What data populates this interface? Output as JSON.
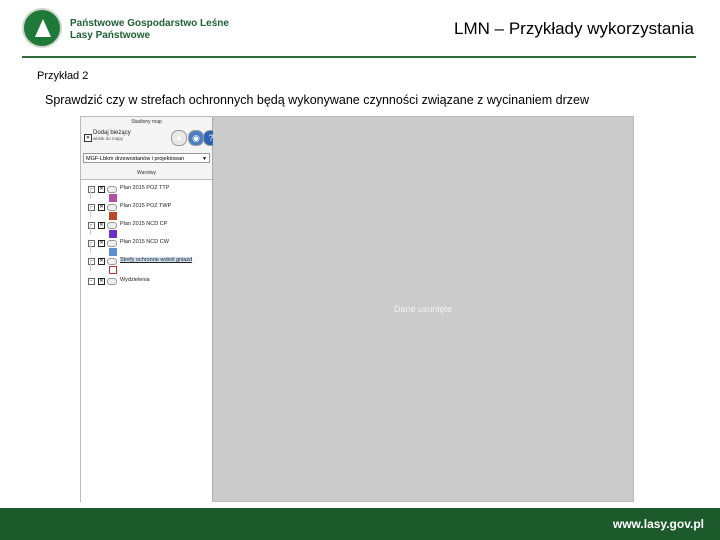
{
  "header": {
    "org_line1": "Państwowe Gospodarstwo Leśne",
    "org_line2": "Lasy Państwowe",
    "title": "LMN – Przykłady wykorzystania"
  },
  "content": {
    "example_label": "Przykład 2",
    "description": "Sprawdzić czy w strefach ochronnych będą wykonywane czynności związane z wycinaniem drzew"
  },
  "qgis": {
    "panel_title": "Stadiony map",
    "add_label": "Dodaj bieżący",
    "add_sub": "widok do mapy",
    "select_value": "MGF-Lbkm drzewostanów i projektowan",
    "layers_title": "Warstwy",
    "layers": [
      {
        "name": "Plan 2015 POZ TTP",
        "swatch": "#b14fa8"
      },
      {
        "name": "Plan 2015 POZ TWP",
        "swatch": "#b84a2a"
      },
      {
        "name": "Plan 2015 NCD CP",
        "swatch": "#6a2fc9"
      },
      {
        "name": "Plan 2015 NCD CW",
        "swatch": "#5c8fd6"
      },
      {
        "name": "Strefy ochronne wokół gniazd",
        "swatch": "#ffffff"
      },
      {
        "name": "Wydzielenia",
        "swatch": ""
      }
    ],
    "canvas_text": "Dane usunięte"
  },
  "footer": {
    "url": "www.lasy.gov.pl"
  },
  "colors": {
    "brand_green": "#1c5a2b",
    "canvas_gray": "#cbcbcb"
  }
}
